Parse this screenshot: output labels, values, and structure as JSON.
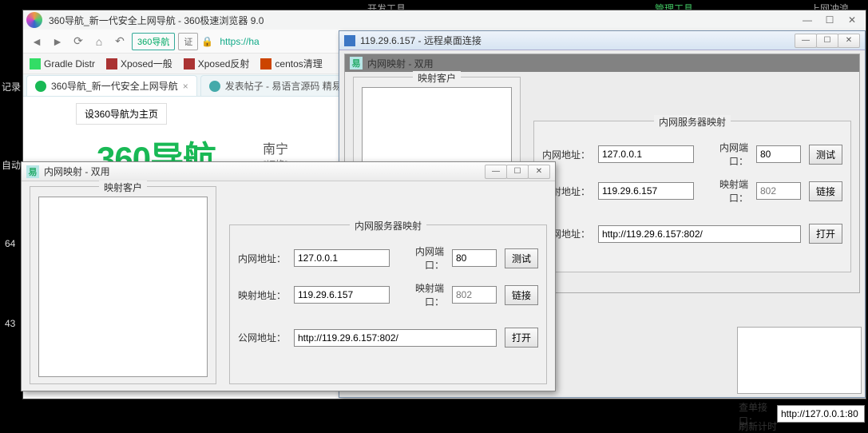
{
  "background": {
    "top_menu": [
      "开发工具",
      "管理工具",
      "上网冲浪"
    ],
    "left_labels": [
      "记录",
      "自动",
      "64",
      "43"
    ]
  },
  "browser": {
    "title": "360导航_新一代安全上网导航 - 360极速浏览器 9.0",
    "chips": {
      "nav": "360导航",
      "cert": "证"
    },
    "lock_glyph": "🔒",
    "url": "https://ha",
    "bookmarks": [
      {
        "label": "Gradle Distr",
        "color": "#3d6"
      },
      {
        "label": "Xposed一般",
        "color": "#a33"
      },
      {
        "label": "Xposed反射",
        "color": "#a33"
      },
      {
        "label": "centos清理",
        "color": "#c40"
      }
    ],
    "tabs": [
      {
        "label": "360导航_新一代安全上网导航",
        "active": true,
        "fav": "#19b955"
      },
      {
        "label": "发表帖子 - 易语言源码 精易论坛",
        "active": false,
        "fav": "#4aa"
      }
    ],
    "page": {
      "set_home": "设360导航为主页",
      "logo_text": "360导航",
      "city": "南宁",
      "switch": "[切换]"
    }
  },
  "app": {
    "title": "内网映射 - 双用",
    "left_group_title": "映射客户",
    "right_group_title": "内网服务器映射",
    "labels": {
      "inner_addr": "内网地址：",
      "inner_port": "内网端口：",
      "map_addr": "映射地址：",
      "map_port": "映射端口：",
      "pub_addr": "公网地址："
    },
    "values": {
      "inner_addr": "127.0.0.1",
      "inner_port": "80",
      "map_addr": "119.29.6.157",
      "map_port": "802",
      "pub_addr": "http://119.29.6.157:802/"
    },
    "buttons": {
      "test": "测试",
      "link": "链接",
      "open": "打开"
    }
  },
  "rdp": {
    "title": "119.29.6.157 - 远程桌面连接",
    "inner_title": "内网映射 - 双用",
    "extra": {
      "check_label": "查单接口：",
      "check_value": "http://127.0.0.1:80",
      "refresh": "刷新计时"
    }
  }
}
